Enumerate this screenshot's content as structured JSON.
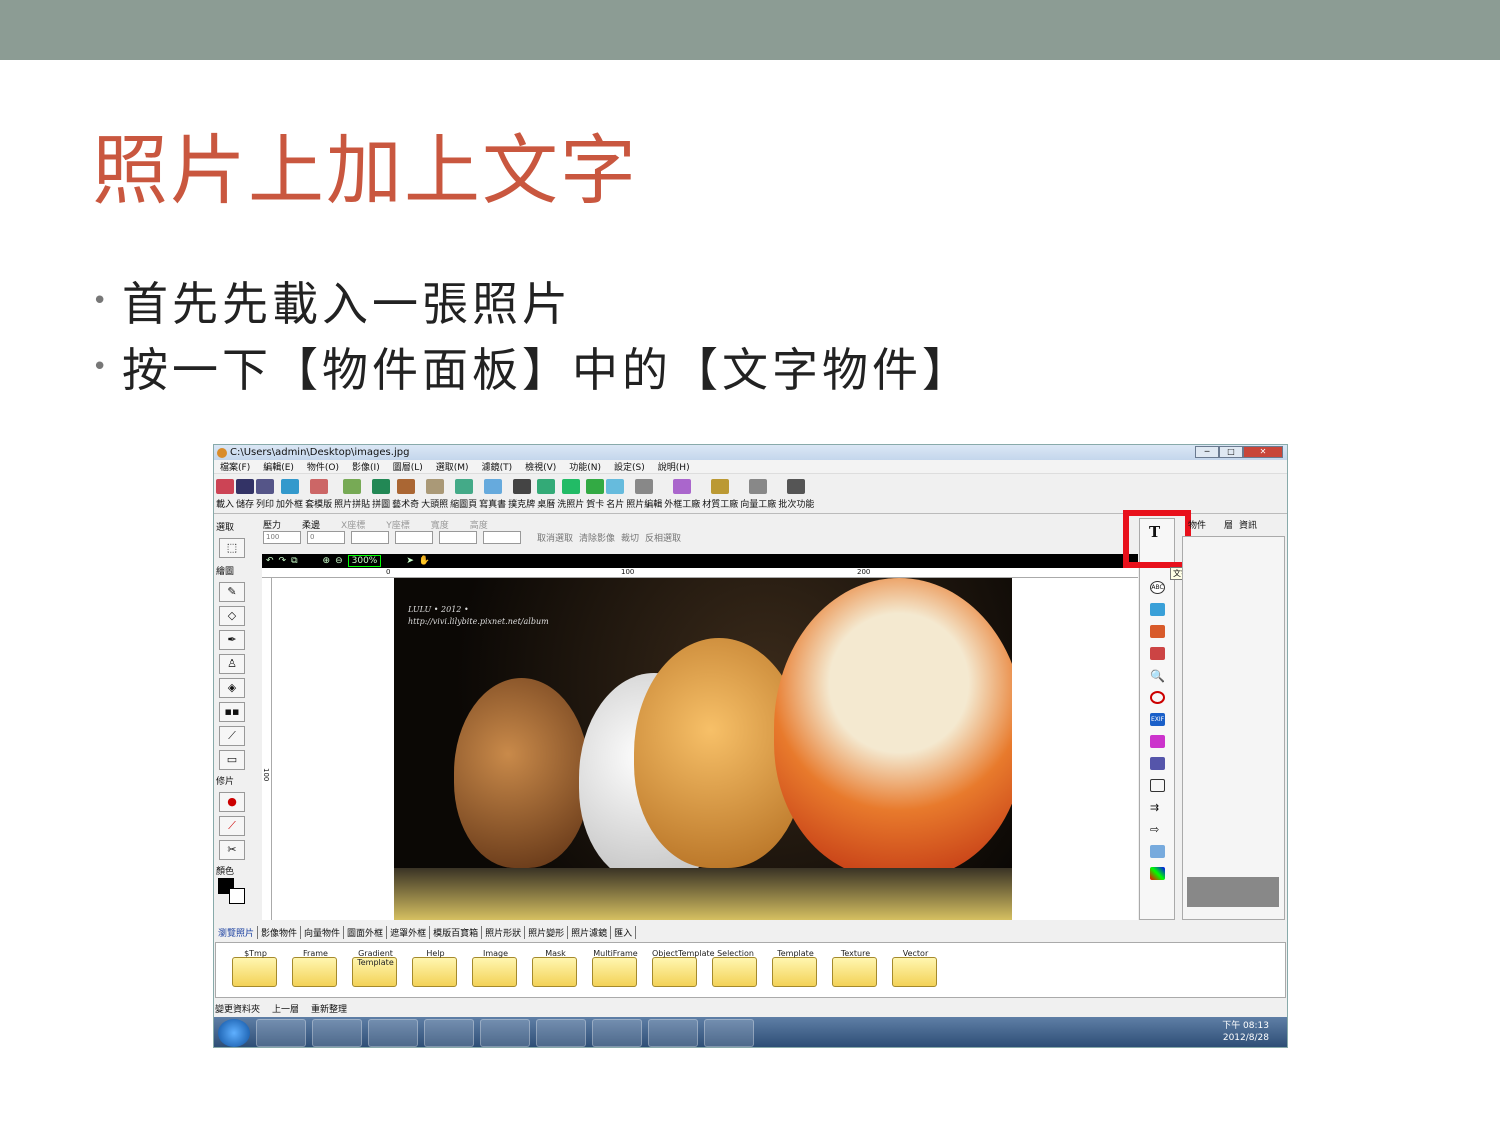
{
  "slide": {
    "title": "照片上加上文字",
    "bullets": [
      "首先先載入一張照片",
      "按一下【物件面板】中的【文字物件】"
    ]
  },
  "window": {
    "path": "C:\\Users\\admin\\Desktop\\images.jpg",
    "menu": [
      "檔案(F)",
      "編輯(E)",
      "物件(O)",
      "影像(I)",
      "圖層(L)",
      "選取(M)",
      "濾鏡(T)",
      "檢視(V)",
      "功能(N)",
      "設定(S)",
      "說明(H)"
    ],
    "toolbar": [
      "載入",
      "儲存",
      "列印",
      "加外框",
      "套模版",
      "照片拼貼",
      "拼圖",
      "藝术奇",
      "大頭照",
      "縮圖頁",
      "寫真書",
      "撲克牌",
      "桌曆",
      "洗照片",
      "賀卡",
      "名片",
      "照片編輯",
      "外框工廠",
      "材質工廠",
      "向量工廠",
      "批次功能"
    ],
    "options": {
      "select": "選取",
      "pressure": "壓力",
      "feather": "柔邊",
      "x": "X座標",
      "y": "Y座標",
      "width": "寬度",
      "height": "高度",
      "pressure_val": "100",
      "feather_val": "0",
      "cancel_sel": "取消選取",
      "clear_img": "清除影像",
      "crop": "裁切",
      "invert": "反相選取"
    },
    "left_groups": [
      "選取",
      "繪圖",
      "修片",
      "顏色"
    ],
    "zoom": "300%",
    "ruler": [
      "0",
      "100",
      "200"
    ],
    "vruler": "100",
    "watermark": [
      "LULU • 2012 •",
      "http://vivi.lilybite.pixnet.net/album"
    ],
    "right_tabs": [
      "物件",
      "層",
      "資訊"
    ],
    "tooltip": "文字物件",
    "bottom_tabs": [
      "瀏覽照片",
      "影像物件",
      "向量物件",
      "圖面外框",
      "遮罩外框",
      "模版百寶箱",
      "照片形狀",
      "照片變形",
      "照片濾鏡",
      "匯入"
    ],
    "folders": [
      "$Tmp",
      "Frame",
      "Gradient Template",
      "Help",
      "Image",
      "Mask",
      "MultiFrame",
      "ObjectTemplate",
      "Selection",
      "Template",
      "Texture",
      "Vector"
    ],
    "status": [
      "變更資料夾",
      "上一層",
      "重新整理"
    ],
    "clock": {
      "time": "下午 08:13",
      "date": "2012/8/28"
    }
  }
}
